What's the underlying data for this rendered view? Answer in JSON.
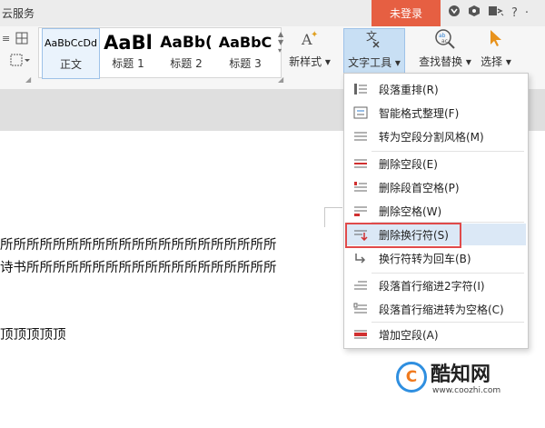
{
  "titlebar": {
    "cloud_label": "云服务",
    "login_label": "未登录",
    "icons": [
      "skin-icon",
      "hex-icon",
      "share-icon",
      "help-icon",
      "more-icon"
    ],
    "help_text": "?",
    "more_text": "·"
  },
  "ribbon": {
    "styles": [
      {
        "sample": "AaBbCcDd",
        "label": "正文"
      },
      {
        "sample": "AaBl",
        "label": "标题 1"
      },
      {
        "sample": "AaBb(",
        "label": "标题 2"
      },
      {
        "sample": "AaBbC",
        "label": "标题 3"
      }
    ],
    "new_style_label": "新样式",
    "text_tools_label": "文字工具",
    "find_replace_label": "查找替换",
    "select_label": "选择"
  },
  "document": {
    "lines": [
      "所所所所所所所所所所所所所所所所所所所所所",
      "诗书所所所所所所所所所所所所所所所所所所所",
      "顶顶顶顶顶"
    ]
  },
  "menu": {
    "items": [
      {
        "label": "段落重排(R)",
        "icon": "paragraph-reflow-icon"
      },
      {
        "label": "智能格式整理(F)",
        "icon": "smart-format-icon"
      },
      {
        "label": "转为空段分割风格(M)",
        "icon": "blank-split-icon"
      },
      {
        "label": "删除空段(E)",
        "icon": "delete-blank-paragraph-icon"
      },
      {
        "label": "删除段首空格(P)",
        "icon": "delete-leading-space-icon"
      },
      {
        "label": "删除空格(W)",
        "icon": "delete-space-icon"
      },
      {
        "label": "删除换行符(S)",
        "icon": "delete-line-break-icon"
      },
      {
        "label": "换行符转为回车(B)",
        "icon": "line-break-to-enter-icon"
      },
      {
        "label": "段落首行缩进2字符(I)",
        "icon": "indent-two-chars-icon"
      },
      {
        "label": "段落首行缩进转为空格(C)",
        "icon": "indent-to-space-icon"
      },
      {
        "label": "增加空段(A)",
        "icon": "add-blank-paragraph-icon"
      }
    ],
    "highlighted_index": 6
  },
  "watermark": {
    "brand": "酷知网",
    "url": "www.coozhi.com",
    "logo_letter": "C"
  },
  "colors": {
    "login_bg": "#e65f42",
    "highlight_border": "#e04a4a",
    "hover_bg": "#dbe8f6",
    "active_tool_bg": "#c8dff4"
  }
}
